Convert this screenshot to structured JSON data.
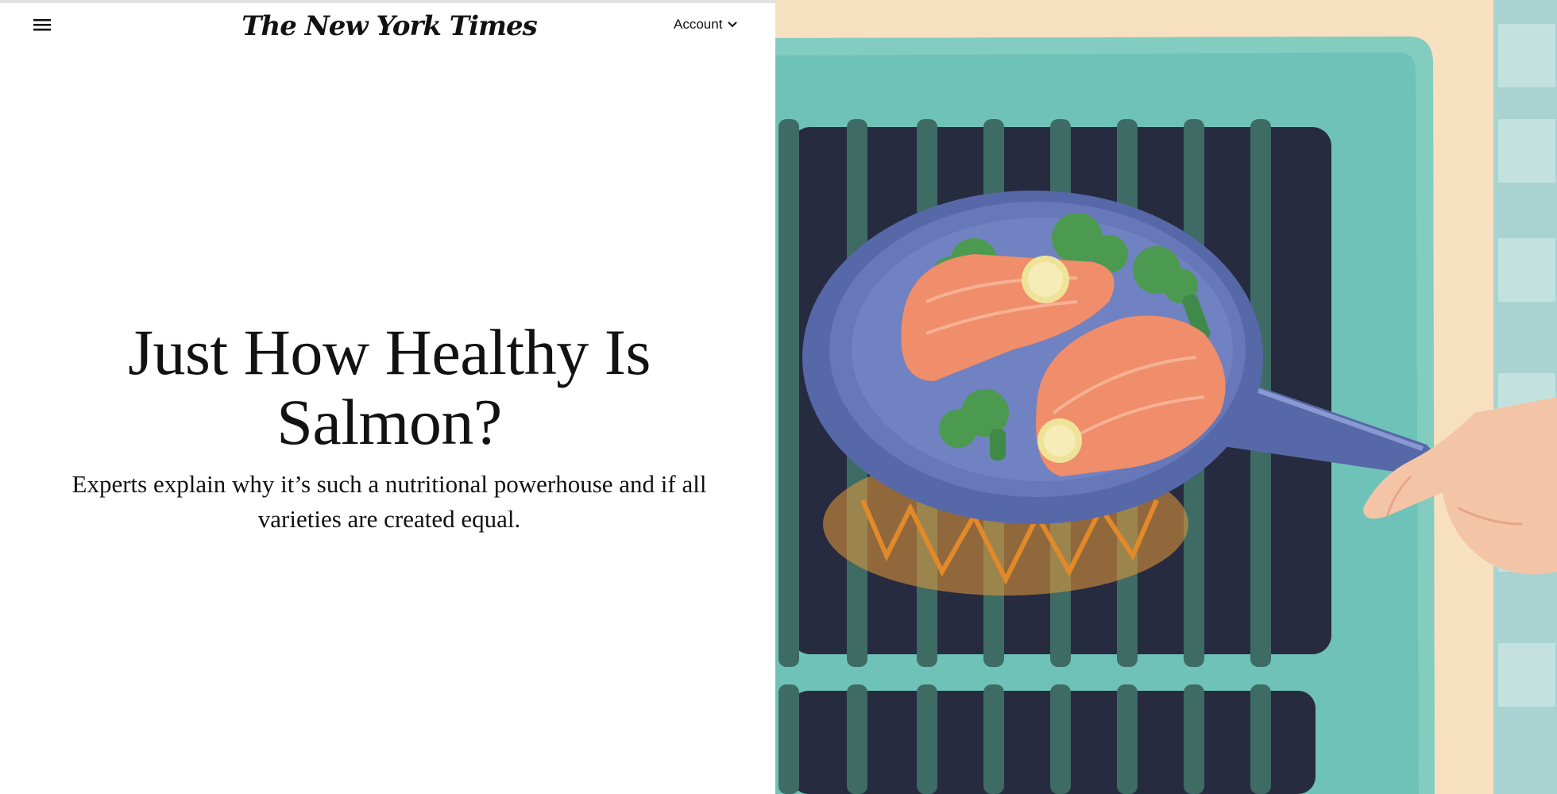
{
  "header": {
    "menu_icon": "hamburger-menu-icon",
    "masthead": "The New York Times",
    "account_label": "Account",
    "account_icon": "chevron-down-icon"
  },
  "article": {
    "headline": "Just How Healthy Is Salmon?",
    "dek": "Experts explain why it’s such a nutritional powerhouse and if all varieties are created equal."
  },
  "illustration": {
    "subject": "salmon-in-pan-illustration",
    "colors": {
      "stove_teal": "#6fc2b7",
      "grate": "#3e6b64",
      "burner_dark": "#262b3f",
      "pan": "#6678b8",
      "salmon": "#f08d6a",
      "broccoli": "#4c9a4f",
      "lemon": "#efe39a",
      "flame": "#e79a3a",
      "hand": "#f4c4a6",
      "wall": "#f7e0c0",
      "tile": "#b9dcd9"
    }
  }
}
